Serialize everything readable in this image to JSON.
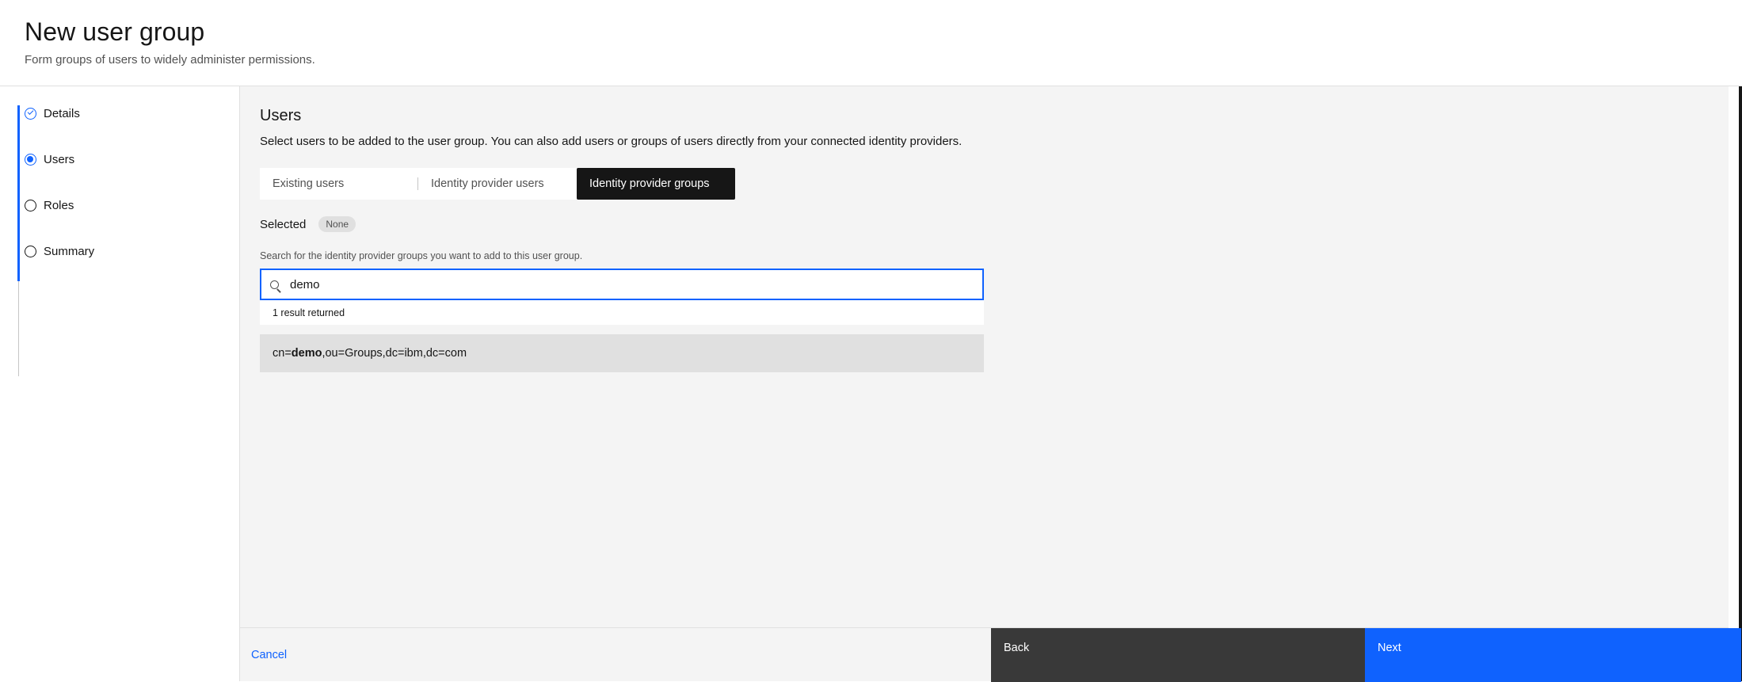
{
  "header": {
    "title": "New user group",
    "subtitle": "Form groups of users to widely administer permissions."
  },
  "steps": [
    {
      "label": "Details",
      "state": "complete"
    },
    {
      "label": "Users",
      "state": "current"
    },
    {
      "label": "Roles",
      "state": "incomplete"
    },
    {
      "label": "Summary",
      "state": "incomplete"
    }
  ],
  "section": {
    "title": "Users",
    "description": "Select users to be added to the user group. You can also add users or groups of users directly from your connected identity providers."
  },
  "tabs": [
    {
      "label": "Existing users",
      "selected": false
    },
    {
      "label": "Identity provider users",
      "selected": false
    },
    {
      "label": "Identity provider groups",
      "selected": true
    }
  ],
  "selected": {
    "label": "Selected",
    "tag": "None"
  },
  "search": {
    "helper": "Search for the identity provider groups you want to add to this user group.",
    "value": "demo",
    "results_count": "1 result returned",
    "results": [
      {
        "prefix": "cn=",
        "match": "demo",
        "suffix": ",ou=Groups,dc=ibm,dc=com"
      }
    ]
  },
  "footer": {
    "cancel": "Cancel",
    "back": "Back",
    "next": "Next"
  },
  "colors": {
    "accent": "#0f62fe",
    "dark": "#161616",
    "background": "#f4f4f4"
  }
}
